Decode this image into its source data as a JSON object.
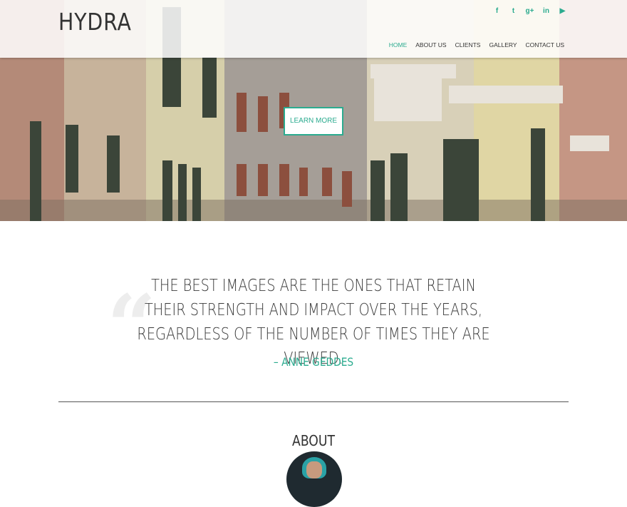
{
  "site": {
    "logo": "HYDRA"
  },
  "social": [
    {
      "name": "facebook-icon",
      "glyph": "f"
    },
    {
      "name": "twitter-icon",
      "glyph": "t"
    },
    {
      "name": "google-plus-icon",
      "glyph": "g+"
    },
    {
      "name": "linkedin-icon",
      "glyph": "in"
    },
    {
      "name": "youtube-icon",
      "glyph": "▶"
    }
  ],
  "nav": {
    "home": "HOME",
    "about": "ABOUT US",
    "clients": "CLIENTS",
    "gallery": "GALLERY",
    "contact": "CONTACT US"
  },
  "hero": {
    "cta_label": "LEARN MORE"
  },
  "quote": {
    "mark": "“",
    "text": "THE BEST IMAGES ARE THE ONES THAT RETAIN THEIR STRENGTH AND IMPACT OVER THE YEARS, REGARDLESS OF THE NUMBER OF TIMES THEY ARE VIEWED.",
    "author": "– ANNE GEDDES"
  },
  "about": {
    "title": "ABOUT"
  },
  "colors": {
    "accent": "#2bab8f",
    "text": "#333333"
  }
}
